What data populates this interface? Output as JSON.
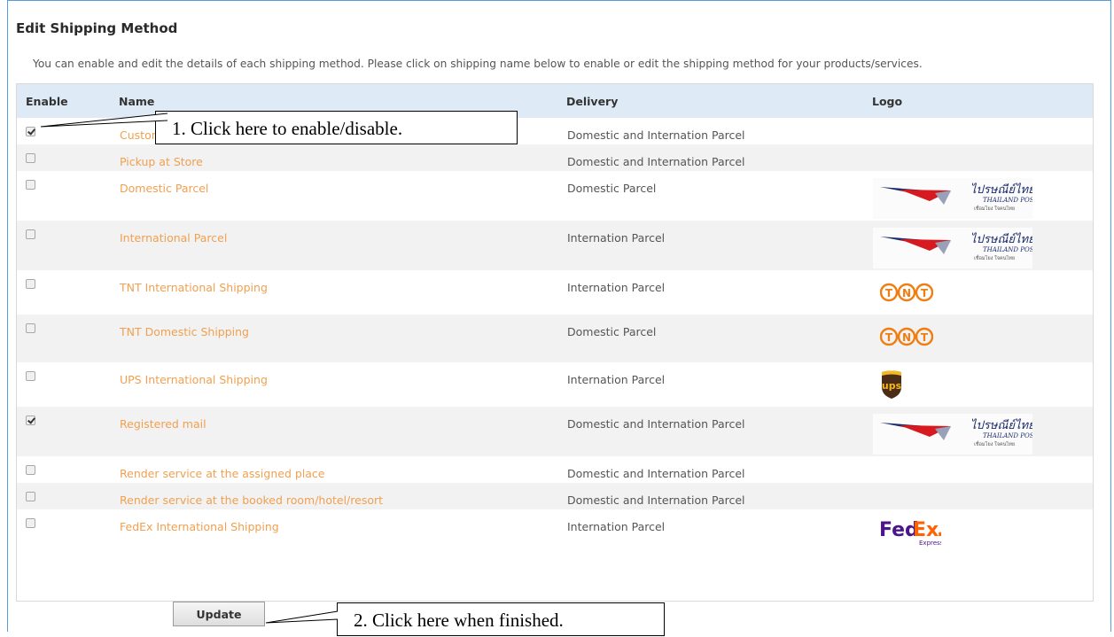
{
  "page": {
    "title": "Edit Shipping Method",
    "description": "You can enable and edit the details of each shipping method. Please click on shipping name below to enable or edit the shipping method for your products/services."
  },
  "table": {
    "headers": {
      "enable": "Enable",
      "name": "Name",
      "delivery": "Delivery",
      "logo": "Logo"
    },
    "rows": [
      {
        "checked": true,
        "name": "Customer Pickup",
        "delivery": "Domestic and Internation Parcel",
        "logo": "none"
      },
      {
        "checked": false,
        "name": "Pickup at Store",
        "delivery": "Domestic and Internation Parcel",
        "logo": "none"
      },
      {
        "checked": false,
        "name": "Domestic Parcel",
        "delivery": "Domestic Parcel",
        "logo": "thailand-post"
      },
      {
        "checked": false,
        "name": "International Parcel",
        "delivery": "Internation Parcel",
        "logo": "thailand-post"
      },
      {
        "checked": false,
        "name": "TNT International Shipping",
        "delivery": "Internation Parcel",
        "logo": "tnt"
      },
      {
        "checked": false,
        "name": "TNT Domestic Shipping",
        "delivery": "Domestic Parcel",
        "logo": "tnt"
      },
      {
        "checked": false,
        "name": "UPS International Shipping",
        "delivery": "Internation Parcel",
        "logo": "ups"
      },
      {
        "checked": true,
        "name": "Registered mail",
        "delivery": "Domestic and Internation Parcel",
        "logo": "thailand-post"
      },
      {
        "checked": false,
        "name": "Render service at the assigned place",
        "delivery": "Domestic and Internation Parcel",
        "logo": "none"
      },
      {
        "checked": false,
        "name": "Render service at the booked room/hotel/resort",
        "delivery": "Domestic and Internation Parcel",
        "logo": "none"
      },
      {
        "checked": false,
        "name": "FedEx International Shipping",
        "delivery": "Internation Parcel",
        "logo": "fedex"
      }
    ]
  },
  "logos": {
    "thailand_post": {
      "line1": "ไปรษณีย์ไทย",
      "line2": "THAILAND POST",
      "line3": "เชื่อมโยง ใจคนไทย"
    },
    "tnt": {
      "letters": [
        "T",
        "N",
        "T"
      ]
    },
    "ups": {
      "text": "ups"
    },
    "fedex": {
      "fed": "Fed",
      "ex": "Ex",
      "dot": ".",
      "sub": "Express"
    }
  },
  "buttons": {
    "update_label": "Update"
  },
  "callouts": {
    "step1": "1. Click here to enable/disable.",
    "step2": "2. Click here when finished."
  },
  "colors": {
    "header_bg": "#deebf7",
    "link": "#f0a050",
    "frame_border": "#5b9bd5",
    "tnt_orange": "#f07d10",
    "ups_brown": "#4a2c17",
    "ups_gold": "#f6b81c",
    "fedex_purple": "#4d148c",
    "fedex_orange": "#ff6200",
    "post_red": "#d71920",
    "post_blue": "#1b2a6b"
  }
}
